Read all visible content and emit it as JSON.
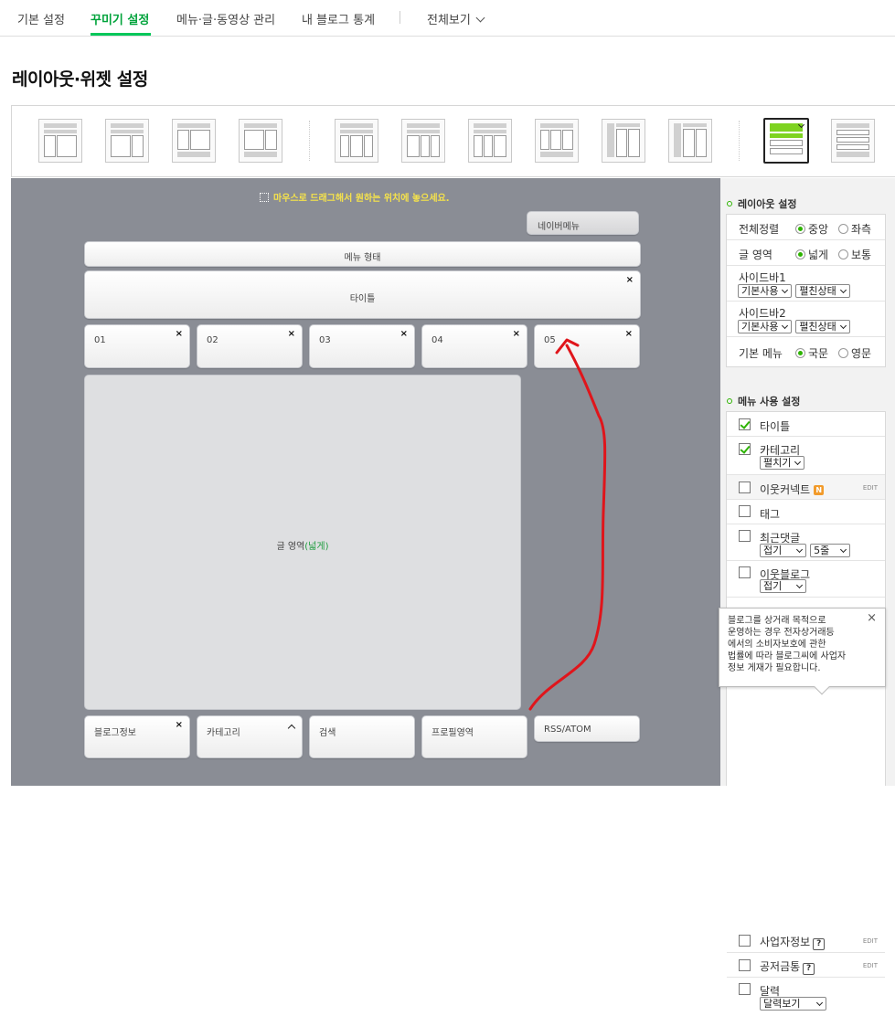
{
  "nav": {
    "tabs": [
      "기본 설정",
      "꾸미기 설정",
      "메뉴·글·동영상 관리",
      "내 블로그 통계"
    ],
    "view_all": "전체보기"
  },
  "page_title": "레이아웃·위젯 설정",
  "canvas": {
    "hint": "마우스로 드래그해서 원하는 위치에 놓으세요.",
    "navi_menu": "네이버메뉴",
    "menu_style": "메뉴 형태",
    "title": "타이틀",
    "slots": [
      "01",
      "02",
      "03",
      "04",
      "05"
    ],
    "content_label": "글 영역",
    "content_mode": "(넓게)",
    "widgets": [
      "블로그정보",
      "카테고리",
      "검색",
      "프로필영역",
      "RSS/ATOM"
    ],
    "close_glyph": "×"
  },
  "layout_settings": {
    "heading": "레이아웃 설정",
    "align_label": "전체정렬",
    "align_options": [
      "중앙",
      "좌측"
    ],
    "content_label": "글 영역",
    "content_options": [
      "넓게",
      "보통"
    ],
    "sidebar1_label": "사이드바1",
    "sidebar2_label": "사이드바2",
    "sidebar_use": "기본사용",
    "sidebar_state": "펼친상태",
    "basic_menu_label": "기본 메뉴",
    "basic_menu_options": [
      "국문",
      "영문"
    ]
  },
  "menu_settings": {
    "heading": "메뉴 사용 설정",
    "items": [
      {
        "label": "타이틀",
        "checked": true
      },
      {
        "label": "카테고리",
        "checked": true,
        "select": "펼치기"
      },
      {
        "label": "이웃커넥트",
        "checked": false,
        "badge": "N",
        "edit": "EDIT"
      },
      {
        "label": "태그",
        "checked": false
      },
      {
        "label": "최근댓글",
        "checked": false,
        "select": "접기",
        "select2": "5줄"
      },
      {
        "label": "이웃블로그",
        "checked": false,
        "select": "접기"
      },
      {
        "label": "사업자정보",
        "checked": false,
        "help": "?",
        "edit": "EDIT"
      },
      {
        "label": "공저금통",
        "checked": false,
        "help": "?",
        "edit": "EDIT"
      },
      {
        "label": "달력",
        "checked": false,
        "select": "달력보기"
      }
    ]
  },
  "tooltip": {
    "text": "블로그를 상거래 목적으로 운영하는 경우 전자상거래등에서의 소비자보호에 관한 법률에 따라 블로그씨에 사업자 정보 게재가 필요합니다.",
    "lines": [
      "블로그를 상거래 목적으로",
      "운영하는 경우 전자상거래등",
      "에서의 소비자보호에 관한",
      "법률에 따라 블로그씨에 사업자",
      "정보 게재가 필요합니다."
    ],
    "close": "×"
  },
  "colors": {
    "accent": "#03c75a",
    "canvas": "#8a8d95",
    "hint": "#f5e24b",
    "annotation": "#e0151b"
  }
}
